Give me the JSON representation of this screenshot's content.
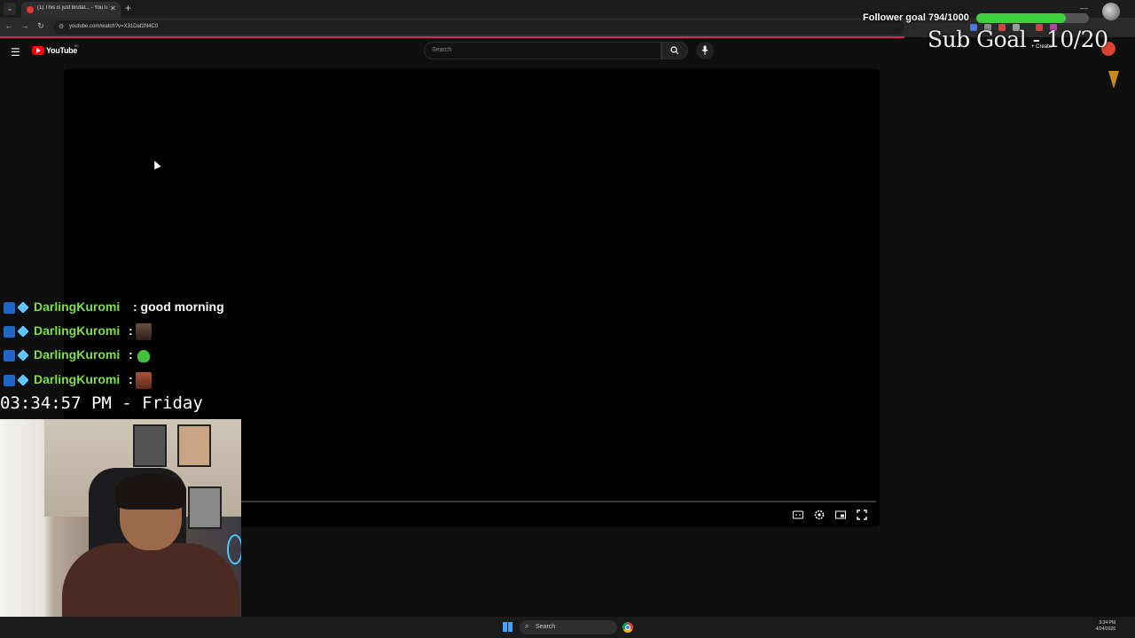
{
  "browser": {
    "tab_title": "(1) This is just brutal... - YouTube",
    "tab_close": "✕",
    "new_tab": "+",
    "url": "youtube.com/watch?v=X31Daf2N4C0",
    "nav": {
      "back": "←",
      "forward": "→",
      "reload": "↻"
    },
    "window_controls": {
      "minimize": "—",
      "maximize": "▢",
      "close": "✕"
    }
  },
  "youtube": {
    "logo_text": "YouTube",
    "region_code": "60",
    "search_placeholder": "Search",
    "create_label": "+ Create"
  },
  "overlay": {
    "follower_goal_text": "Follower goal 794/1000",
    "follower_progress": 0.794,
    "sub_goal_text": "Sub Goal - 10/20",
    "clock": "03:34:57 PM - Friday",
    "chat": [
      {
        "user": "DarlingKuromi",
        "message": ": good morning",
        "emote": ""
      },
      {
        "user": "DarlingKuromi",
        "message": ":",
        "emote": "face-emote"
      },
      {
        "user": "DarlingKuromi",
        "message": ":",
        "emote": "green-emote"
      },
      {
        "user": "DarlingKuromi",
        "message": ":",
        "emote": "red-face-emote"
      }
    ]
  },
  "taskbar": {
    "search_text": "Search",
    "time": "3:34 PM",
    "date": "4/24/2026"
  },
  "colors": {
    "chat_user": "#7fe04a",
    "follower_fill": "#3ecf3e",
    "youtube_red": "#ff0000",
    "loadbar": "#e0245e"
  }
}
